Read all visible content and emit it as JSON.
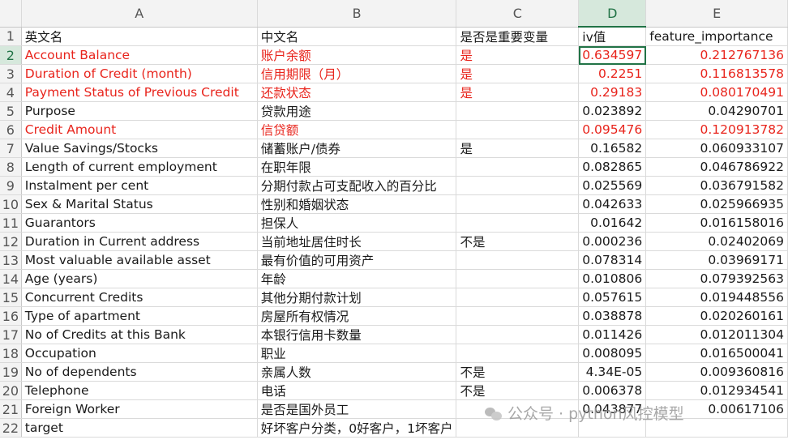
{
  "columns": [
    "A",
    "B",
    "C",
    "D",
    "E"
  ],
  "active_column": "D",
  "selected_row": 2,
  "rows": [
    {
      "n": "1",
      "a": "英文名",
      "b": "中文名",
      "c": "是否是重要变量",
      "d": "iv值",
      "e": "feature_importance",
      "red": false
    },
    {
      "n": "2",
      "a": "Account Balance",
      "b": "账户余额",
      "c": "是",
      "d": "0.634597",
      "e": "0.212767136",
      "red": true
    },
    {
      "n": "3",
      "a": "Duration of Credit (month)",
      "b": "信用期限（月）",
      "c": "是",
      "d": "0.2251",
      "e": "0.116813578",
      "red": true
    },
    {
      "n": "4",
      "a": "Payment Status of Previous Credit",
      "b": "还款状态",
      "c": "是",
      "d": "0.29183",
      "e": "0.080170491",
      "red": true
    },
    {
      "n": "5",
      "a": "Purpose",
      "b": "贷款用途",
      "c": "",
      "d": "0.023892",
      "e": "0.04290701",
      "red": false
    },
    {
      "n": "6",
      "a": "Credit Amount",
      "b": "信贷额",
      "c": "",
      "d": "0.095476",
      "e": "0.120913782",
      "red": true
    },
    {
      "n": "7",
      "a": "Value Savings/Stocks",
      "b": "储蓄账户/债券",
      "c": "是",
      "d": "0.16582",
      "e": "0.060933107",
      "red": false
    },
    {
      "n": "8",
      "a": "Length of current employment",
      "b": "在职年限",
      "c": "",
      "d": "0.082865",
      "e": "0.046786922",
      "red": false
    },
    {
      "n": "9",
      "a": "Instalment per cent",
      "b": "分期付款占可支配收入的百分比",
      "c": "",
      "d": "0.025569",
      "e": "0.036791582",
      "red": false
    },
    {
      "n": "10",
      "a": "Sex & Marital Status",
      "b": "性别和婚姻状态",
      "c": "",
      "d": "0.042633",
      "e": "0.025966935",
      "red": false
    },
    {
      "n": "11",
      "a": "Guarantors",
      "b": "担保人",
      "c": "",
      "d": "0.01642",
      "e": "0.016158016",
      "red": false
    },
    {
      "n": "12",
      "a": "Duration in Current address",
      "b": "当前地址居住时长",
      "c": "不是",
      "d": "0.000236",
      "e": "0.02402069",
      "red": false
    },
    {
      "n": "13",
      "a": "Most valuable available asset",
      "b": "最有价值的可用资产",
      "c": "",
      "d": "0.078314",
      "e": "0.03969171",
      "red": false
    },
    {
      "n": "14",
      "a": "Age (years)",
      "b": "年龄",
      "c": "",
      "d": "0.010806",
      "e": "0.079392563",
      "red": false
    },
    {
      "n": "15",
      "a": "Concurrent Credits",
      "b": "其他分期付款计划",
      "c": "",
      "d": "0.057615",
      "e": "0.019448556",
      "red": false
    },
    {
      "n": "16",
      "a": "Type of apartment",
      "b": "房屋所有权情况",
      "c": "",
      "d": "0.038878",
      "e": "0.020260161",
      "red": false
    },
    {
      "n": "17",
      "a": "No of Credits at this Bank",
      "b": "本银行信用卡数量",
      "c": "",
      "d": "0.011426",
      "e": "0.012011304",
      "red": false
    },
    {
      "n": "18",
      "a": "Occupation",
      "b": "职业",
      "c": "",
      "d": "0.008095",
      "e": "0.016500041",
      "red": false
    },
    {
      "n": "19",
      "a": "No of dependents",
      "b": "亲属人数",
      "c": "不是",
      "d": "4.34E-05",
      "e": "0.009360816",
      "red": false
    },
    {
      "n": "20",
      "a": "Telephone",
      "b": "电话",
      "c": "不是",
      "d": "0.006378",
      "e": "0.012934541",
      "red": false
    },
    {
      "n": "21",
      "a": "Foreign Worker",
      "b": "是否是国外员工",
      "c": "",
      "d": "0.043877",
      "e": "0.00617106",
      "red": false
    },
    {
      "n": "22",
      "a": "target",
      "b": "好坏客户分类，0好客户，1坏客户",
      "c": "",
      "d": "",
      "e": "",
      "red": false
    }
  ],
  "watermark": "公众号 · python风控模型",
  "colors": {
    "red_text": "#e8241c",
    "accent": "#217346",
    "header_bg": "#f3f3f3",
    "grid": "#dadada"
  }
}
